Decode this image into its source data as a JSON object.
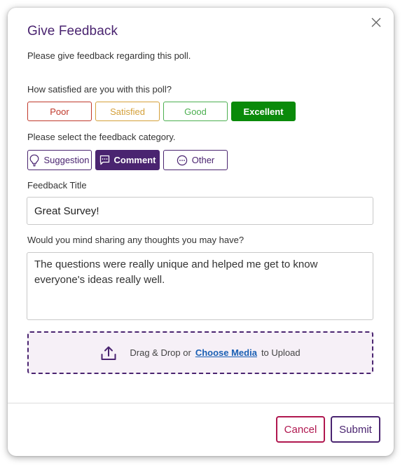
{
  "dialog": {
    "title": "Give Feedback",
    "intro": "Please give feedback regarding this poll.",
    "close_icon": "close-icon"
  },
  "satisfaction": {
    "question": "How satisfied are you with this poll?",
    "options": [
      {
        "label": "Poor",
        "color": "#c0392b",
        "selected": false
      },
      {
        "label": "Satisfied",
        "color": "#d4a03a",
        "selected": false
      },
      {
        "label": "Good",
        "color": "#4caf50",
        "selected": false
      },
      {
        "label": "Excellent",
        "color": "#0a8a0a",
        "selected": true
      }
    ]
  },
  "category": {
    "question": "Please select the feedback category.",
    "options": [
      {
        "label": "Suggestion",
        "icon": "lightbulb-icon",
        "selected": false
      },
      {
        "label": "Comment",
        "icon": "comment-icon",
        "selected": true
      },
      {
        "label": "Other",
        "icon": "ellipsis-circle-icon",
        "selected": false
      }
    ]
  },
  "feedback_title": {
    "label": "Feedback Title",
    "value": "Great Survey!"
  },
  "thoughts": {
    "label": "Would you mind sharing any thoughts you may have?",
    "value": "The questions were really unique and helped me get to know everyone's ideas really well."
  },
  "upload": {
    "icon": "upload-icon",
    "prefix": "Drag & Drop or",
    "link": "Choose Media",
    "suffix": "to Upload"
  },
  "footer": {
    "cancel_label": "Cancel",
    "submit_label": "Submit",
    "cancel_color": "#b0174f",
    "submit_color": "#4a2470"
  },
  "colors": {
    "accent": "#4a2470"
  }
}
